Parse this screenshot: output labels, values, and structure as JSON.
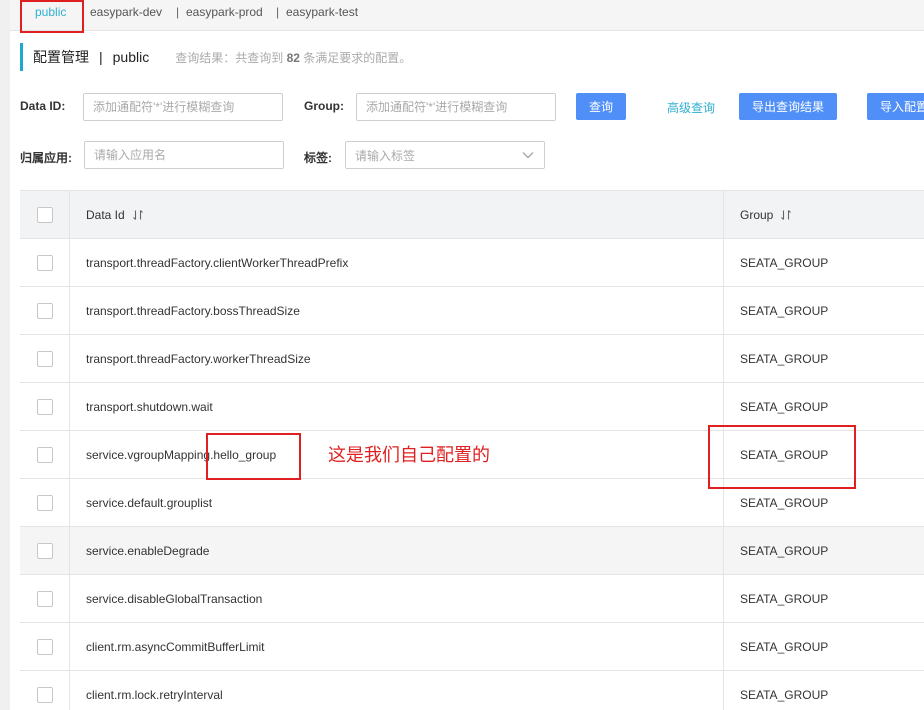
{
  "namespaces": [
    {
      "label": "public",
      "active": true
    },
    {
      "label": "easypark-dev",
      "active": false
    },
    {
      "label": "easypark-prod",
      "active": false
    },
    {
      "label": "easypark-test",
      "active": false
    }
  ],
  "ns_separator": "|",
  "header": {
    "title": "配置管理",
    "separator": "|",
    "namespace": "public",
    "summary_prefix": "查询结果：共查询到",
    "summary_count": "82",
    "summary_suffix": "条满足要求的配置。"
  },
  "filters": {
    "data_id_label": "Data ID:",
    "data_id_placeholder": "添加通配符'*'进行模糊查询",
    "group_label": "Group:",
    "group_placeholder": "添加通配符'*'进行模糊查询",
    "query_button": "查询",
    "advanced_query": "高级查询",
    "export_button": "导出查询结果",
    "import_button": "导入配置",
    "app_label": "归属应用:",
    "app_placeholder": "请输入应用名",
    "tag_label": "标签:",
    "tag_placeholder": "请输入标签"
  },
  "table": {
    "columns": [
      "Data Id",
      "Group"
    ],
    "rows": [
      {
        "data_id": "transport.threadFactory.clientWorkerThreadPrefix",
        "group": "SEATA_GROUP"
      },
      {
        "data_id": "transport.threadFactory.bossThreadSize",
        "group": "SEATA_GROUP"
      },
      {
        "data_id": "transport.threadFactory.workerThreadSize",
        "group": "SEATA_GROUP"
      },
      {
        "data_id": "transport.shutdown.wait",
        "group": "SEATA_GROUP"
      },
      {
        "data_id": "service.vgroupMapping.hello_group",
        "group": "SEATA_GROUP"
      },
      {
        "data_id": "service.default.grouplist",
        "group": "SEATA_GROUP"
      },
      {
        "data_id": "service.enableDegrade",
        "group": "SEATA_GROUP"
      },
      {
        "data_id": "service.disableGlobalTransaction",
        "group": "SEATA_GROUP"
      },
      {
        "data_id": "client.rm.asyncCommitBufferLimit",
        "group": "SEATA_GROUP"
      },
      {
        "data_id": "client.rm.lock.retryInterval",
        "group": "SEATA_GROUP"
      }
    ]
  },
  "annotation": {
    "text": "这是我们自己配置的",
    "color": "#e02020"
  },
  "colors": {
    "accent": "#1fa8cf",
    "primary_button": "#4f8ff7",
    "link": "#2fb0d0"
  }
}
